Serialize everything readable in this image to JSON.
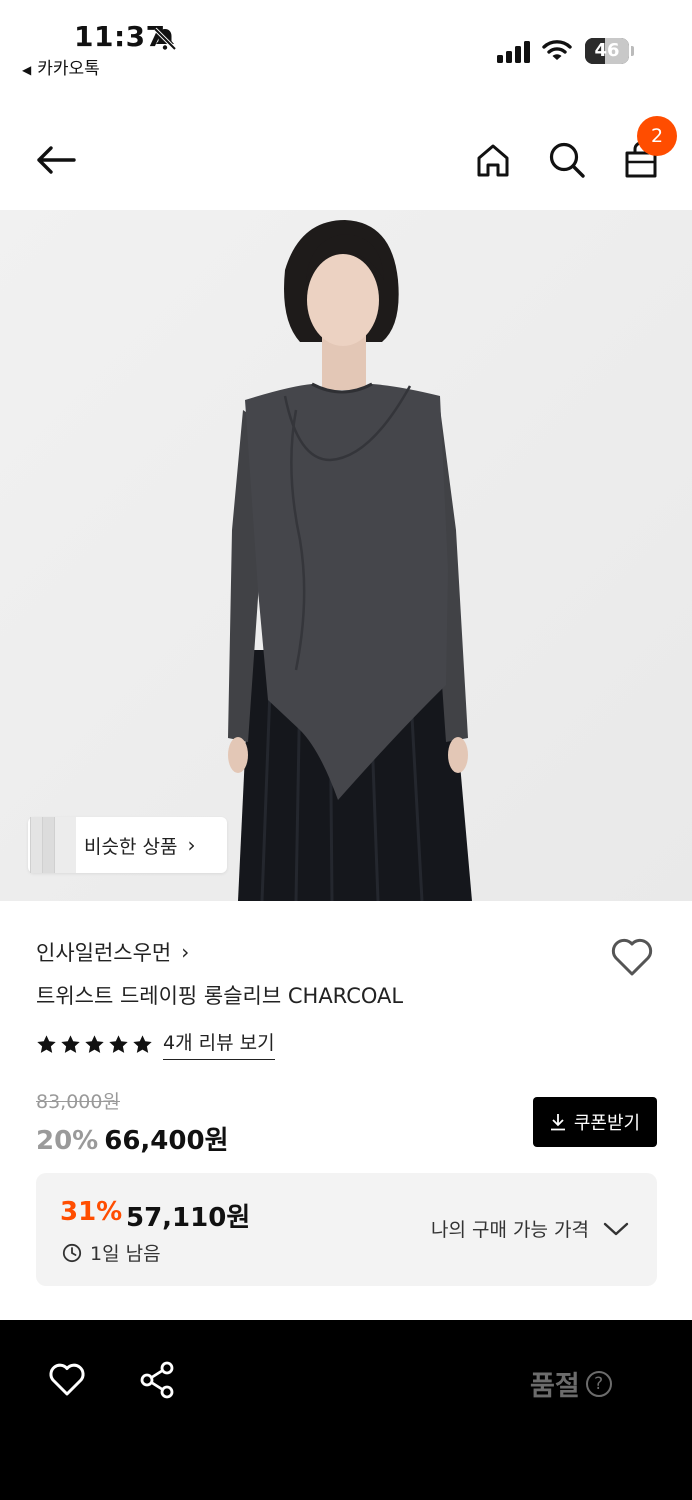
{
  "status_bar": {
    "time": "11:37",
    "back_app": "카카오톡",
    "battery_level": "46",
    "battery_percent": 46
  },
  "header": {
    "back_icon": "arrow-left-icon",
    "home_icon": "home-icon",
    "search_icon": "search-icon",
    "cart_icon": "shopping-bag-icon",
    "cart_count": "2",
    "badge_color": "#ff4d00"
  },
  "hero": {
    "similar_products_label": "비슷한 상품"
  },
  "product": {
    "brand": "인사일런스우먼",
    "title": "트위스트 드레이핑 롱슬리브 CHARCOAL",
    "rating_stars": 5,
    "review_link": "4개 리뷰 보기",
    "original_price": "83,000원",
    "discount": "20%",
    "price": "66,400원",
    "coupon_label": "쿠폰받기"
  },
  "my_price": {
    "discount": "31%",
    "price": "57,110원",
    "time_left": "1일 남음",
    "toggle_label": "나의 구매 가능 가격",
    "accent_color": "#ff4d00"
  },
  "bottom_bar": {
    "heart_icon": "heart-icon",
    "share_icon": "share-icon",
    "soldout_label": "품절",
    "help_glyph": "?"
  }
}
